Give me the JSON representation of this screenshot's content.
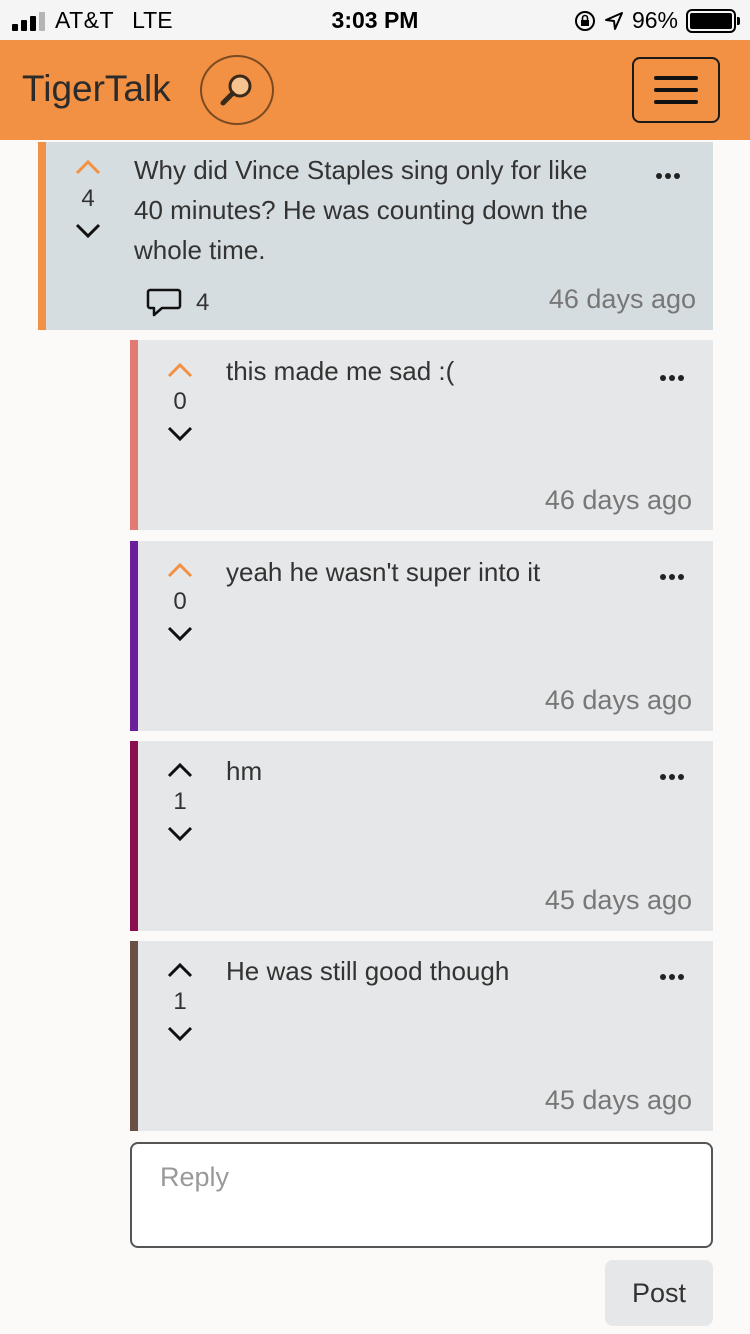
{
  "status_bar": {
    "carrier": "AT&T",
    "network": "LTE",
    "time": "3:03 PM",
    "battery": "96%"
  },
  "navbar": {
    "brand": "TigerTalk",
    "accent_color": "#f29143"
  },
  "post": {
    "votes": "4",
    "text": "Why did Vince Staples sing only for like 40 minutes? He was counting down the whole time.",
    "comment_count": "4",
    "age": "46 days ago",
    "upvoted": true
  },
  "replies": [
    {
      "votes": "0",
      "text": "this made me sad :(",
      "age": "46 days ago",
      "color": "#e07a73",
      "upvoted": true
    },
    {
      "votes": "0",
      "text": "yeah he wasn't super into it",
      "age": "46 days ago",
      "color": "#6a1f9c",
      "upvoted": true
    },
    {
      "votes": "1",
      "text": "hm",
      "age": "45 days ago",
      "color": "#8b0f4e",
      "upvoted": false
    },
    {
      "votes": "1",
      "text": "He was still good though",
      "age": "45 days ago",
      "color": "#6b4f45",
      "upvoted": false
    }
  ],
  "reply_box": {
    "placeholder": "Reply",
    "post_label": "Post"
  }
}
